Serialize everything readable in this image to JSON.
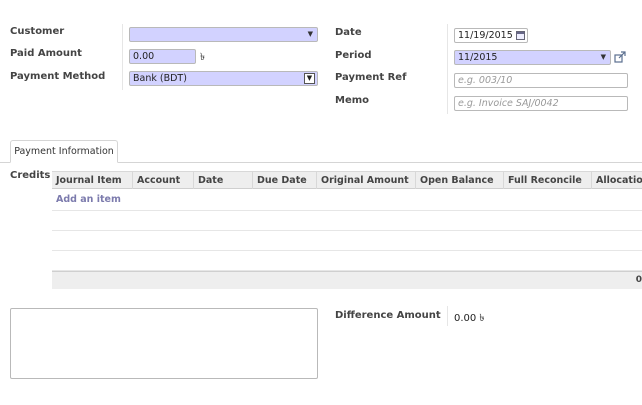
{
  "form": {
    "customer_label": "Customer",
    "customer_value": "",
    "paid_amount_label": "Paid Amount",
    "paid_amount_value": "0.00",
    "currency_symbol": "৳",
    "payment_method_label": "Payment Method",
    "payment_method_value": "Bank (BDT)",
    "date_label": "Date",
    "date_value": "11/19/2015",
    "period_label": "Period",
    "period_value": "11/2015",
    "payment_ref_label": "Payment Ref",
    "payment_ref_placeholder": "e.g. 003/10",
    "memo_label": "Memo",
    "memo_placeholder": "e.g. Invoice SAJ/0042"
  },
  "tabs": [
    {
      "label": "Payment Information"
    }
  ],
  "credits": {
    "label": "Credits",
    "columns": [
      "Journal Item",
      "Account",
      "Date",
      "Due Date",
      "Original Amount",
      "Open Balance",
      "Full Reconcile",
      "Allocation"
    ],
    "add_item_label": "Add an item",
    "footer_total": "0"
  },
  "bottom": {
    "difference_label": "Difference Amount",
    "difference_value": "0.00 ৳"
  },
  "colors": {
    "required_field": "#d2d2ff",
    "link": "#7c7bad"
  },
  "icons": [
    "dropdown-caret-icon",
    "calendar-icon",
    "external-link-icon",
    "select-arrow-icon"
  ]
}
